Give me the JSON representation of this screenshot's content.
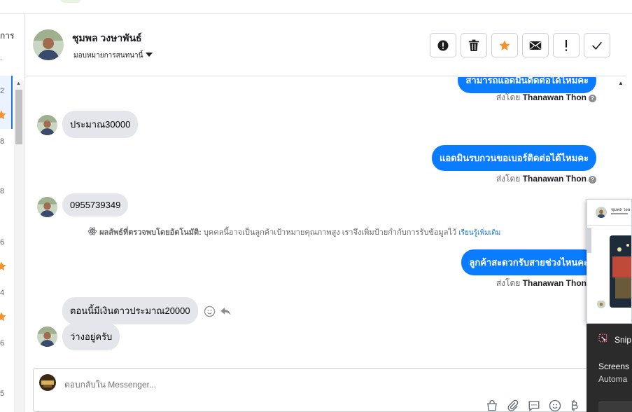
{
  "left_rail": {
    "label_top": "การ",
    "counts": [
      "2",
      "8",
      "8",
      "6",
      "4",
      "6",
      "5"
    ]
  },
  "header": {
    "contact_name": "ชุมพล วงษาพันธ์",
    "assign_label": "มอบหมายการสนทนานี้",
    "actions": [
      "alert-circle-icon",
      "trash-icon",
      "star-icon",
      "envelope-icon",
      "exclamation-icon",
      "check-icon"
    ]
  },
  "conversation": {
    "sent_by_prefix": "ส่งโดย",
    "sender": "Thanawan Thon",
    "messages": [
      {
        "dir": "out",
        "text": "สามารถแอดมินติดต่อได้ไหมคะ"
      },
      {
        "dir": "in",
        "text": "ประมาณ30000"
      },
      {
        "dir": "out",
        "text": "แอดมินรบกวนขอเบอร์ติดต่อได้ไหมคะ"
      },
      {
        "dir": "in",
        "text": "0955739349"
      },
      {
        "dir": "out",
        "text": "ลูกค้าสะดวกรับสายช่วงไหนคะ"
      },
      {
        "dir": "in",
        "text": "ตอนนี้มีเงินดาวประมาณ20000"
      },
      {
        "dir": "in",
        "text": "ว่างอยู่ครับ"
      }
    ],
    "auto_note": {
      "title": "ผลลัพธ์ที่ตรวจพบโดยอัตโนมัติ:",
      "body": "บุคคลนี้อาจเป็นลูกค้าเป้าหมายคุณภาพสูง เราจึงเพิ่มป้ายกำกับการรับข้อมูลไว้",
      "link": "เรียนรู้เพิ่มเติม"
    }
  },
  "composer": {
    "placeholder": "ตอบกลับใน Messenger..."
  },
  "snip": {
    "card_name": "ชุมพล วงษ",
    "app_name": "Snip",
    "line1": "Screens",
    "line2": "Automa"
  },
  "colors": {
    "brand_blue": "#0a7cff",
    "incoming_bubble": "#e4e6eb",
    "star_orange": "#f5922b"
  }
}
